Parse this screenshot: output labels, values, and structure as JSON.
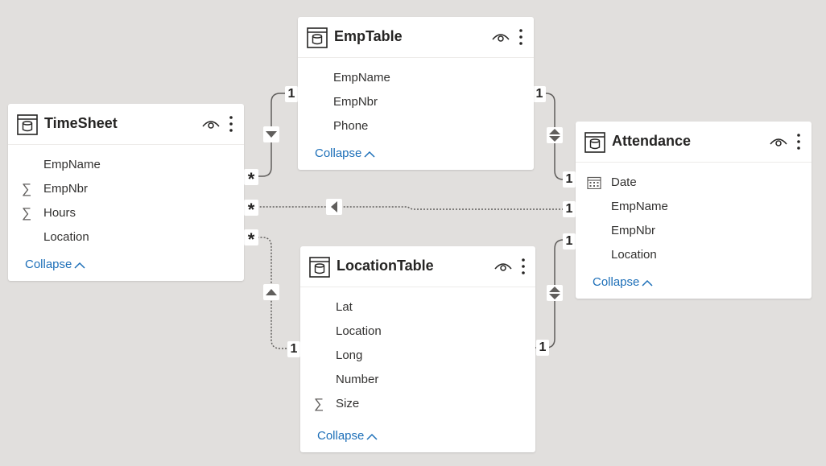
{
  "tables": {
    "emptable": {
      "title": "EmpTable",
      "fields": [
        "EmpName",
        "EmpNbr",
        "Phone"
      ],
      "collapse_label": "Collapse"
    },
    "timesheet": {
      "title": "TimeSheet",
      "fields": [
        "EmpName",
        "EmpNbr",
        "Hours",
        "Location"
      ],
      "field_icons": [
        "",
        "sigma-icon",
        "sigma-icon",
        ""
      ],
      "collapse_label": "Collapse"
    },
    "attendance": {
      "title": "Attendance",
      "fields": [
        "Date",
        "EmpName",
        "EmpNbr",
        "Location"
      ],
      "field_icons": [
        "calendar-icon",
        "",
        "",
        ""
      ],
      "collapse_label": "Collapse"
    },
    "locationtable": {
      "title": "LocationTable",
      "fields": [
        "Lat",
        "Location",
        "Long",
        "Number",
        "Size"
      ],
      "field_icons": [
        "",
        "",
        "",
        "",
        "sigma-icon"
      ],
      "collapse_label": "Collapse"
    }
  },
  "relationships": {
    "emp_timesheet": {
      "from_cardinality": "1",
      "to_cardinality": "*",
      "direction": "single-down",
      "style": "solid"
    },
    "emp_attendance": {
      "from_cardinality": "1",
      "to_cardinality": "1",
      "direction": "both",
      "style": "solid"
    },
    "attendance_timesheet": {
      "from_cardinality": "1",
      "to_cardinality": "*",
      "direction": "single-left",
      "style": "dashed"
    },
    "location_timesheet": {
      "from_cardinality": "1",
      "to_cardinality": "*",
      "direction": "single-up",
      "style": "dashed"
    },
    "location_attendance": {
      "from_cardinality": "1",
      "to_cardinality": "1",
      "direction": "both",
      "style": "solid"
    }
  },
  "colors": {
    "canvas": "#e1dfdd",
    "card": "#ffffff",
    "link": "#1d6fb8",
    "line": "#605e5c"
  }
}
